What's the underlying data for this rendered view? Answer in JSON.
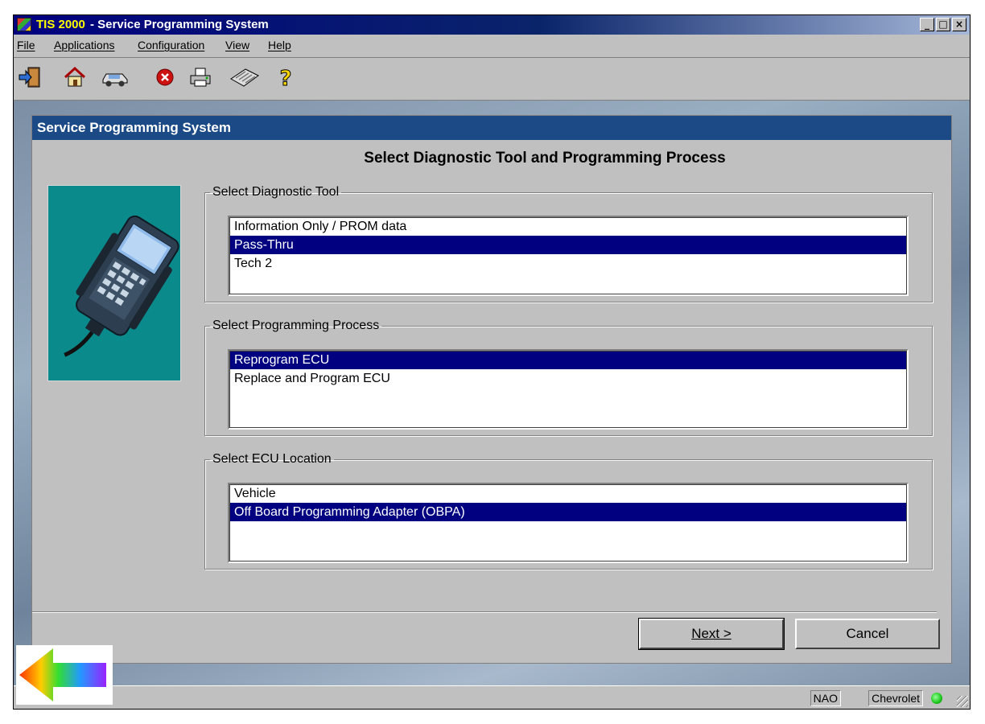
{
  "window": {
    "title_app": "TIS 2000",
    "title_rest": "- Service Programming System",
    "minimize_glyph": "_",
    "maximize_glyph": "□",
    "close_glyph": "×"
  },
  "menu": [
    {
      "label": "File"
    },
    {
      "label": "Applications"
    },
    {
      "label": "Configuration"
    },
    {
      "label": "View"
    },
    {
      "label": "Help"
    }
  ],
  "toolbar": {
    "icons": [
      "exit-icon",
      "home-icon",
      "vehicle-icon",
      "stop-icon",
      "print-icon",
      "keyboard-icon",
      "help-icon"
    ]
  },
  "panel": {
    "title": "Service Programming System",
    "heading": "Select Diagnostic Tool and Programming Process"
  },
  "diagnostic_tool": {
    "legend": "Select Diagnostic Tool",
    "options": [
      "Information Only / PROM data",
      "Pass-Thru",
      "Tech 2"
    ],
    "selected": "Pass-Thru"
  },
  "programming_process": {
    "legend": "Select Programming Process",
    "options": [
      "Reprogram ECU",
      "Replace and Program ECU"
    ],
    "selected": "Reprogram ECU"
  },
  "ecu_location": {
    "legend": "Select ECU Location",
    "options": [
      "Vehicle",
      "Off Board Programming Adapter (OBPA)"
    ],
    "selected": "Off Board Programming Adapter (OBPA)"
  },
  "buttons": {
    "next": "Next >",
    "cancel": "Cancel"
  },
  "statusbar": {
    "region": "NAO",
    "make": "Chevrolet",
    "status_color": "#22cc22"
  },
  "colors": {
    "title_bar": "#000080",
    "panel_title": "#1b4a86",
    "selection": "#000080",
    "image_bg": "#0b8a8c"
  }
}
